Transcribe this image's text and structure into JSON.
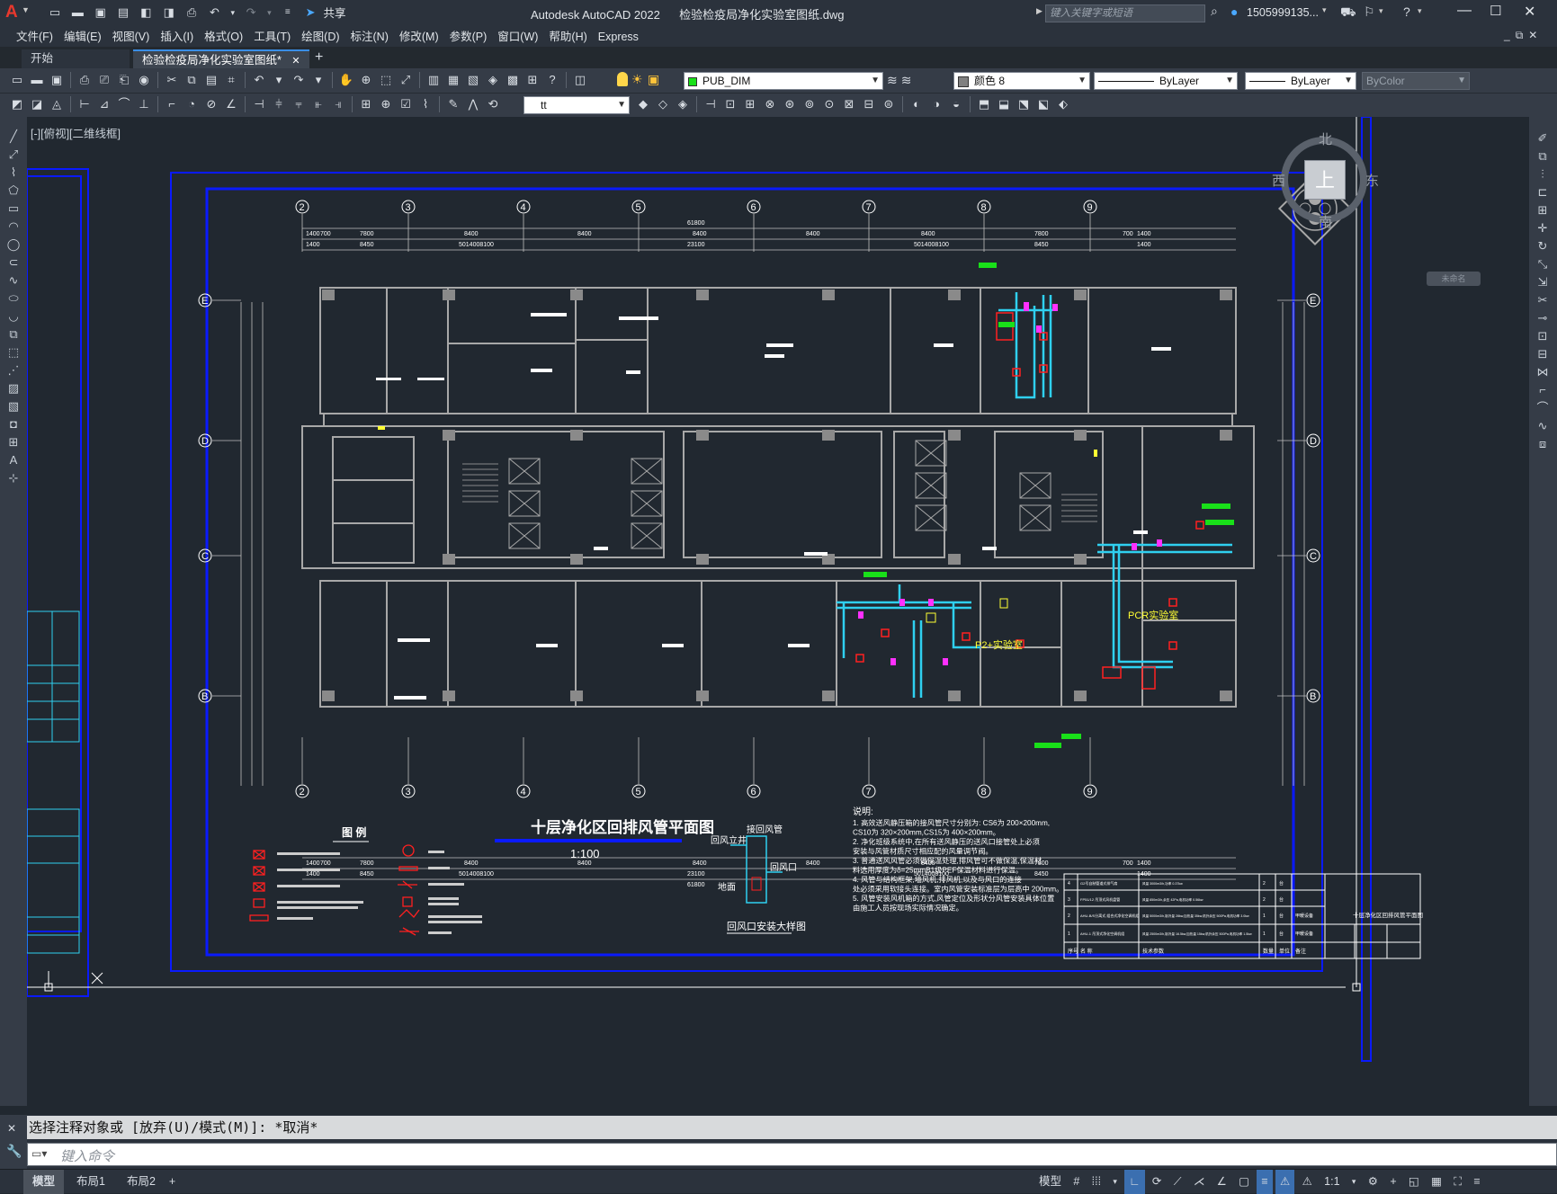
{
  "app": {
    "title": "Autodesk AutoCAD 2022",
    "filename": "检验检疫局净化实验室图纸.dwg",
    "share_label": "共享",
    "search_placeholder": "键入关键字或短语",
    "user": "1505999135...",
    "logo_letter": "A"
  },
  "menu": [
    "文件(F)",
    "编辑(E)",
    "视图(V)",
    "插入(I)",
    "格式(O)",
    "工具(T)",
    "绘图(D)",
    "标注(N)",
    "修改(M)",
    "参数(P)",
    "窗口(W)",
    "帮助(H)",
    "Express"
  ],
  "doc_tabs": {
    "start": "开始",
    "active": "检验检疫局净化实验室图纸*",
    "close": "✕",
    "add": "+"
  },
  "ribbon": {
    "layer": "PUB_DIM",
    "color": "颜色 8",
    "linetype": "ByLayer",
    "lineweight": "ByLayer",
    "plotstyle": "ByColor",
    "textstyle": "tt"
  },
  "viewport_label": "[-][俯视][二维线框]",
  "viewcube": {
    "north": "北",
    "south": "南",
    "east": "东",
    "west": "西",
    "top": "上",
    "wcs": "未命名"
  },
  "drawing": {
    "title": "十层净化区回排风管平面图",
    "scale": "1:100",
    "legend_title": "图 例",
    "detail_title": "回风口安装大样图",
    "detail_labels": [
      "接回风管",
      "回风立井",
      "回风口",
      "地面"
    ],
    "room_labels": [
      "P2+实验室",
      "PCR实验室"
    ],
    "notes_title": "说明:",
    "notes": [
      "1. 高效送风静压箱的接风管尺寸分别为: CS6为 200×200mm,",
      "   CS10为 320×200mm,CS15为 400×200mm。",
      "2. 净化班级系统中,在所有送风静压的送风口接管处上必须",
      "   安装与风管材质尺寸相应配的风量调节阀。",
      "3. 普通送风风管必须做保温处理,排风管可不做保温,保温材",
      "   料选用厚度为δ=25mmB1级PEF保温材料进行保温。",
      "4. 风管与结构框架,墙风机,排风机,以及与风口的连接",
      "   处必须采用软接头连接。室内风管安装标准层为层高中 200mm。",
      "5. 风管安装风机箱的方式,风管定位及形状分风管安装具体位置",
      "   由施工人员按现场实际情况确定。"
    ],
    "grid_top": [
      "2",
      "3",
      "4",
      "5",
      "6",
      "7",
      "8",
      "9"
    ],
    "grid_side": [
      "E",
      "D",
      "C",
      "B"
    ],
    "dims_top_total": "61800",
    "dims_top_row1": [
      "1400",
      "700",
      "7800",
      "8400",
      "8400",
      "8400",
      "8400",
      "8400",
      "7800",
      "700",
      "1400"
    ],
    "dims_top_row2": [
      "1400",
      "8450",
      "5014008100",
      "23100",
      "5014008100",
      "8450",
      "1400"
    ],
    "table_headers": [
      "序号",
      "名 称",
      "技术参数",
      "数量",
      "单位",
      "备注"
    ],
    "table_rows": [
      [
        "4",
        "G2号自制管道式排气扇",
        "风量 3000m3/h,功率 0.37kw",
        "2",
        "台",
        ""
      ],
      [
        "3",
        "FP51/12 吊顶式风机盘管",
        "风量 850m3/h,余压 42Pa,电机功率 0.56kw",
        "2",
        "台",
        ""
      ],
      [
        "2",
        "AHU-B/S分离式 组合式净化空调机组",
        "风量 5000m3/h,制冷量 28kw,加热量 35kw,机外余压 500Pa,电机功率 3.0kw",
        "1",
        "台",
        "甲暖设备"
      ],
      [
        "1",
        "AHU-1 吊顶式净化空调机组",
        "风量 2500m3/h,制冷量 16.5kw,加热量 15kw,机外余压 500Pa,电机功率 1.5kw",
        "1",
        "台",
        "甲暖设备"
      ]
    ],
    "titleblock": "十层净化区回排风管平面图"
  },
  "command": {
    "history": "选择注释对象或 [放弃(U)/模式(M)]: *取消*",
    "prompt": "键入命令"
  },
  "layout_tabs": [
    "模型",
    "布局1",
    "布局2"
  ],
  "status": {
    "model": "模型",
    "scale": "1:1"
  },
  "colors": {
    "frame_blue": "#0a1aff",
    "walls": "#a8a8a8",
    "duct_cyan": "#2fd0f0",
    "red_marks": "#ff2020",
    "magenta": "#ff30ff",
    "green": "#19e019",
    "yellow": "#ffff33"
  }
}
